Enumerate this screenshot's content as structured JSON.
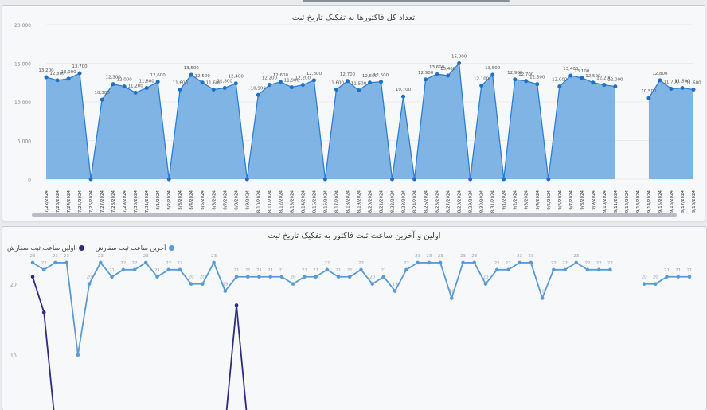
{
  "colors": {
    "area_fill": "#6aa8e0",
    "area_line": "#2e7fd1",
    "marker": "#1f6fc2",
    "first_series": "#5b9bd5",
    "last_series": "#2e2a7c"
  },
  "top_chart": {
    "title": "تعداد کل فاکتورها به تفکیک تاریخ ثبت",
    "ytick_labels": [
      "0",
      "5,000",
      "10,000",
      "15,000",
      "20,000"
    ]
  },
  "bottom_chart": {
    "title": "اولین و آخرین ساعت ثبت فاکتور به تفکیک تاریخ ثبت",
    "ytick_labels": [
      "10",
      "20"
    ]
  },
  "chart_data": [
    {
      "type": "area",
      "title": "تعداد کل فاکتورها به تفکیک تاریخ ثبت",
      "xlabel": "",
      "ylabel": "",
      "ylim": [
        0,
        20000
      ],
      "grid": true,
      "categories": [
        "7/22/2024",
        "7/23/2024",
        "7/24/2024",
        "7/25/2024",
        "7/26/2024",
        "7/27/2024",
        "7/28/2024",
        "7/29/2024",
        "7/30/2024",
        "7/31/2024",
        "8/1/2024",
        "8/2/2024",
        "8/3/2024",
        "8/4/2024",
        "8/5/2024",
        "8/6/2024",
        "8/7/2024",
        "8/8/2024",
        "8/9/2024",
        "8/10/2024",
        "8/11/2024",
        "8/12/2024",
        "8/13/2024",
        "8/14/2024",
        "8/15/2024",
        "8/16/2024",
        "8/17/2024",
        "8/18/2024",
        "8/19/2024",
        "8/20/2024",
        "8/21/2024",
        "8/22/2024",
        "8/23/2024",
        "8/24/2024",
        "8/25/2024",
        "8/26/2024",
        "8/27/2024",
        "8/28/2024",
        "8/29/2024",
        "8/30/2024",
        "8/31/2024",
        "9/1/2024",
        "9/2/2024",
        "9/3/2024",
        "9/4/2024",
        "9/5/2024",
        "9/6/2024",
        "9/7/2024",
        "9/8/2024",
        "9/9/2024",
        "9/10/2024",
        "9/11/2024",
        "9/12/2024",
        "9/13/2024",
        "9/14/2024",
        "9/15/2024",
        "9/16/2024",
        "9/17/2024",
        "9/18/2024"
      ],
      "values": [
        13200,
        12800,
        13000,
        13700,
        0,
        10300,
        12300,
        12000,
        11200,
        11800,
        12600,
        0,
        11600,
        13500,
        12500,
        11600,
        11800,
        12400,
        0,
        10900,
        12200,
        12600,
        11900,
        12200,
        12800,
        0,
        11600,
        12700,
        11500,
        12500,
        12600,
        0,
        10700,
        0,
        12900,
        13600,
        13400,
        15000,
        0,
        12100,
        13500,
        0,
        12900,
        12700,
        12300,
        0,
        12000,
        13400,
        13100,
        12500,
        12200,
        12000,
        null,
        null,
        10500,
        12800,
        11700,
        11800,
        11600
      ],
      "value_labels": [
        "13,200",
        "12,800",
        "13,000",
        "13,700",
        "",
        "10,300",
        "12,300",
        "12,000",
        "11,200",
        "11,800",
        "12,600",
        "",
        "11,600",
        "13,500",
        "12,500",
        "11,600",
        "11,800",
        "12,400",
        "",
        "10,900",
        "12,200",
        "12,600",
        "11,900",
        "12,200",
        "12,800",
        "",
        "11,600",
        "12,700",
        "11,500",
        "12,500",
        "12,600",
        "",
        "10,700",
        "",
        "12,900",
        "13,600",
        "13,400",
        "15,000",
        "",
        "12,100",
        "13,500",
        "",
        "12,900",
        "12,700",
        "12,300",
        "",
        "12,000",
        "13,400",
        "13,100",
        "12,500",
        "12,200",
        "12,000",
        "",
        "",
        "10,500",
        "12,800",
        "11,700",
        "11,800",
        "11,600"
      ]
    },
    {
      "type": "line",
      "title": "اولین و آخرین ساعت ثبت فاکتور به تفکیک تاریخ ثبت",
      "ylim": [
        0,
        24
      ],
      "grid": false,
      "legend": "top-left",
      "series": [
        {
          "name": "اولین ساعت ثبت سفارش",
          "values": [
            21,
            16,
            0,
            0,
            0,
            0,
            0,
            0,
            0,
            0,
            0,
            0,
            0,
            0,
            0,
            0,
            0,
            0,
            17,
            0,
            0,
            0,
            0,
            0,
            0,
            0,
            0,
            0,
            0,
            0,
            0,
            0,
            0,
            0,
            0,
            0,
            0,
            0,
            0,
            0,
            0,
            0,
            0,
            0,
            0,
            0,
            0,
            0,
            0,
            0,
            0,
            0,
            null,
            null,
            null,
            null,
            null,
            null,
            null
          ]
        },
        {
          "name": "آخرین ساعت ثبت سفارش",
          "values": [
            23,
            22,
            23,
            23,
            10,
            20,
            23,
            21,
            22,
            22,
            23,
            21,
            22,
            22,
            20,
            20,
            23,
            19,
            21,
            21,
            21,
            21,
            21,
            20,
            21,
            21,
            22,
            21,
            21,
            22,
            20,
            21,
            19,
            22,
            23,
            23,
            23,
            18,
            23,
            23,
            20,
            22,
            22,
            23,
            23,
            18,
            22,
            22,
            23,
            22,
            22,
            22,
            null,
            null,
            20,
            20,
            21,
            21,
            21
          ]
        }
      ],
      "data_labels": "23"
    }
  ]
}
